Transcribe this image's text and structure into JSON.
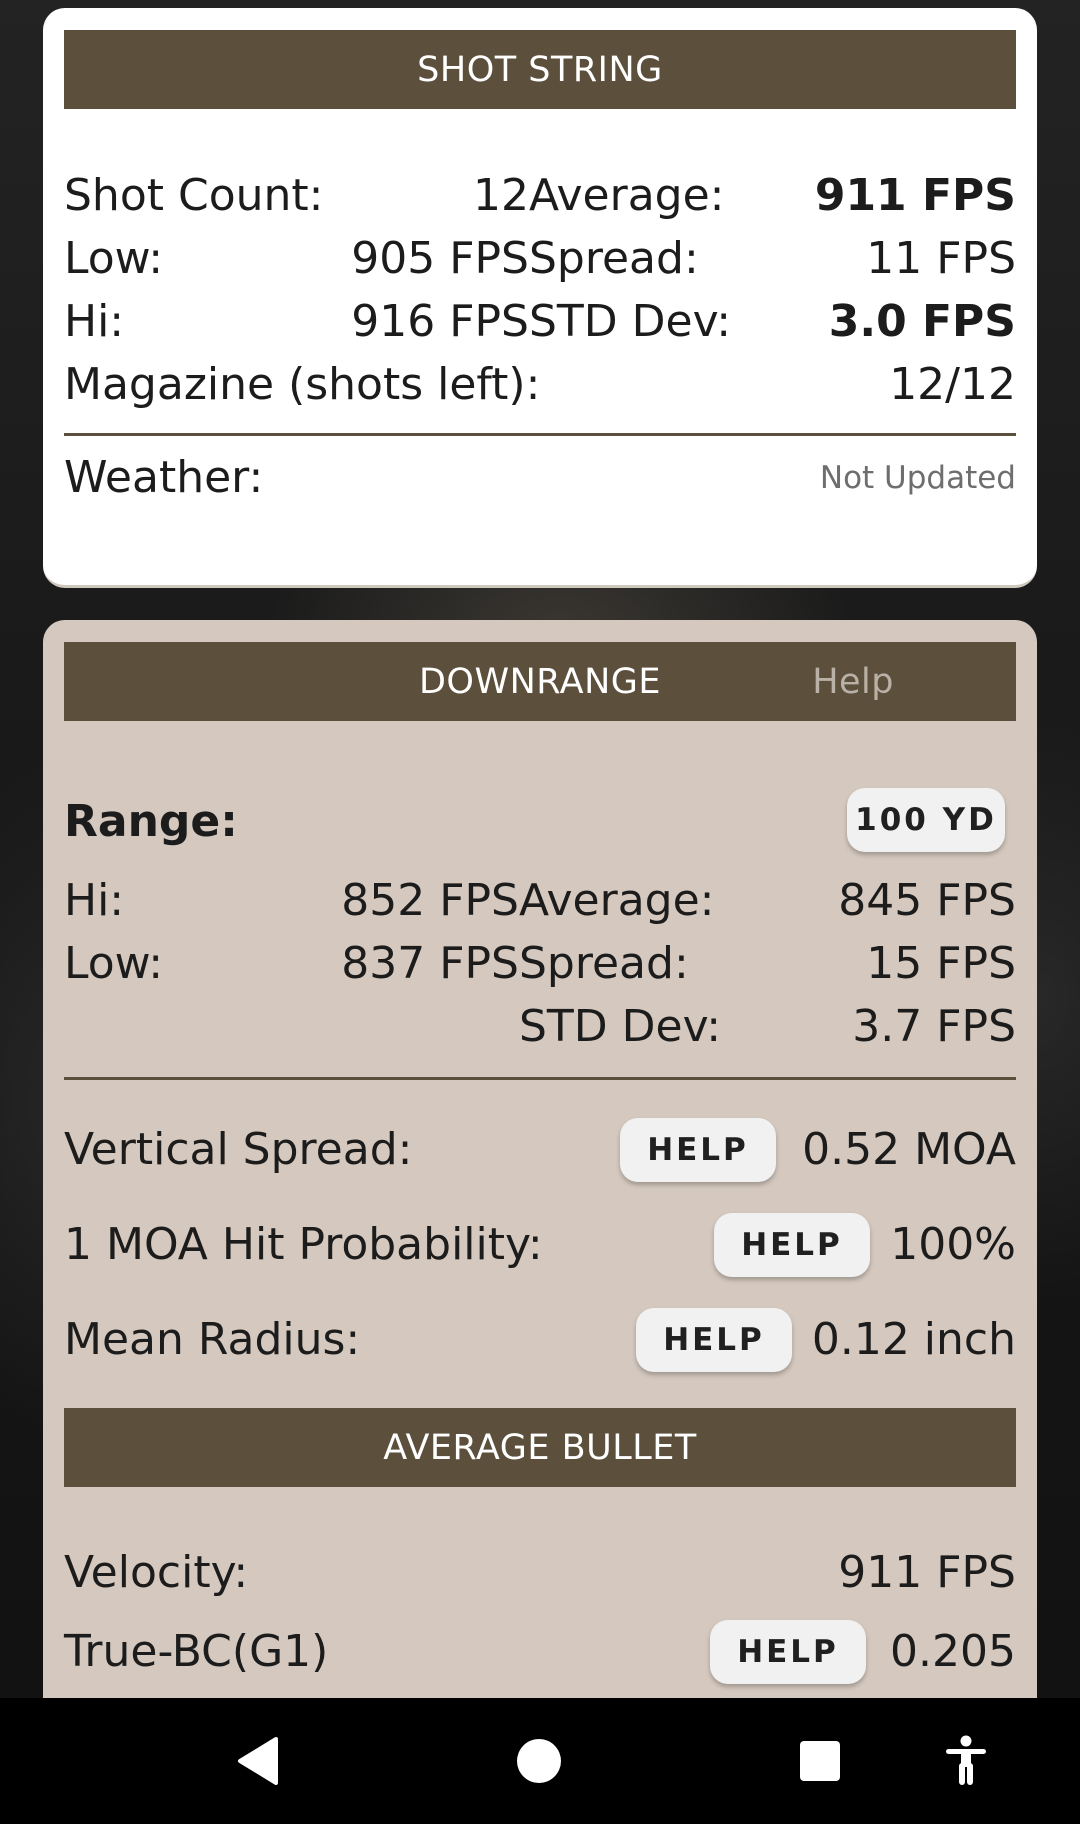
{
  "shot_string": {
    "header": "SHOT STRING",
    "shot_count_label": "Shot Count:",
    "shot_count_value": "12",
    "low_label": "Low:",
    "low_value": "905 FPS",
    "hi_label": "Hi:",
    "hi_value": "916 FPS",
    "average_label": "Average:",
    "average_value": "911 FPS",
    "spread_label": "Spread:",
    "spread_value": "11 FPS",
    "std_label": "STD Dev:",
    "std_value": "3.0 FPS",
    "magazine_label": "Magazine (shots left):",
    "magazine_value": "12/12",
    "weather_label": "Weather:",
    "weather_value": "Not Updated"
  },
  "downrange": {
    "header": "DOWNRANGE",
    "help_link": "Help",
    "range_label": "Range:",
    "range_button": "100 YD",
    "hi_label": "Hi:",
    "hi_value": "852 FPS",
    "low_label": "Low:",
    "low_value": "837 FPS",
    "average_label": "Average:",
    "average_value": "845 FPS",
    "spread_label": "Spread:",
    "spread_value": "15 FPS",
    "std_label": "STD Dev:",
    "std_value": "3.7 FPS",
    "vertical_spread_label": "Vertical Spread:",
    "vertical_spread_value": "0.52 MOA",
    "hit_prob_label": "1 MOA Hit Probability:",
    "hit_prob_value": "100%",
    "mean_radius_label": "Mean Radius:",
    "mean_radius_value": "0.12 inch",
    "help_button": "HELP"
  },
  "average_bullet": {
    "header": "AVERAGE BULLET",
    "velocity_label": "Velocity:",
    "velocity_value": "911 FPS",
    "bc_label": "True-BC(G1)",
    "bc_value": "0.205",
    "help_button": "HELP"
  },
  "navbar": {
    "back": "back-icon",
    "home": "home-icon",
    "recents": "recents-icon",
    "accessibility": "accessibility-icon"
  },
  "colors": {
    "header_bar": "#5c4f3c",
    "card2_background": "#d5c9bf",
    "card1_background": "#ffffff"
  }
}
